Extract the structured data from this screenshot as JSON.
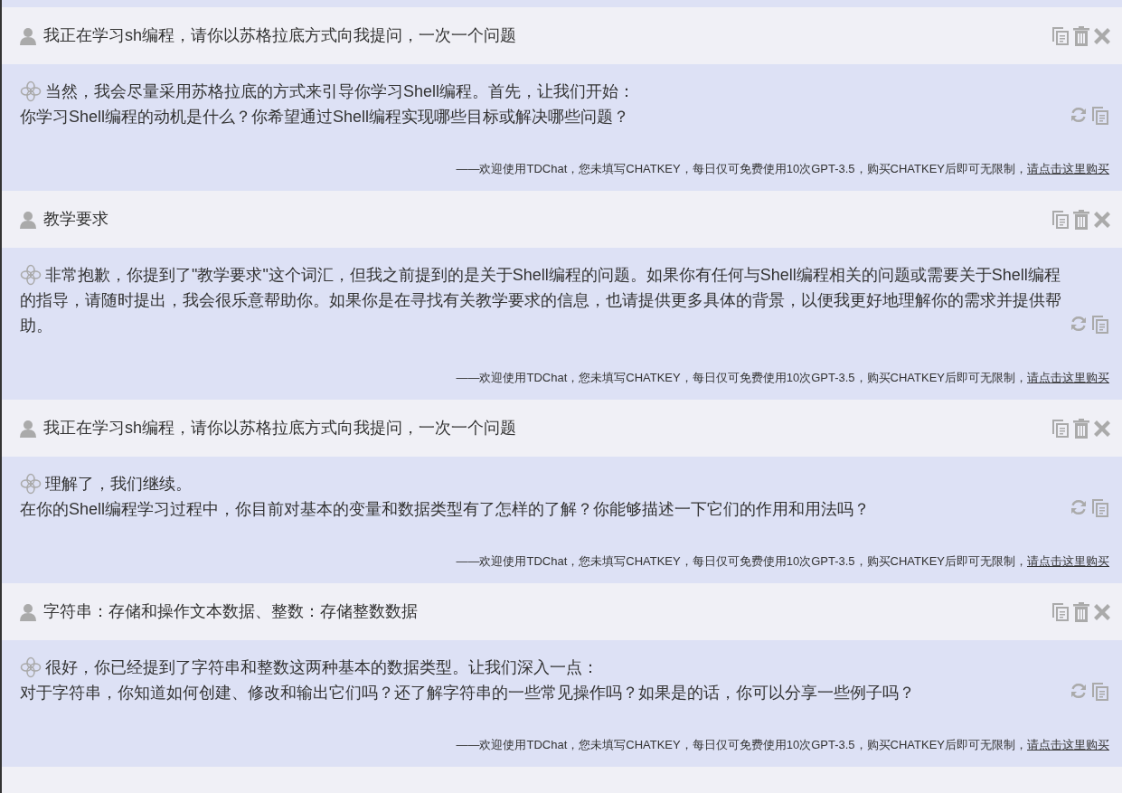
{
  "messages": [
    {
      "kind": "user",
      "text": "我正在学习sh编程，请你以苏格拉底方式向我提问，一次一个问题"
    },
    {
      "kind": "assistant",
      "lines": [
        "当然，我会尽量采用苏格拉底的方式来引导你学习Shell编程。首先，让我们开始：",
        "你学习Shell编程的动机是什么？你希望通过Shell编程实现哪些目标或解决哪些问题？"
      ],
      "notice": "——欢迎使用TDChat，您未填写CHATKEY，每日仅可免费使用10次GPT-3.5，购买CHATKEY后即可无限制，",
      "link": "请点击这里购买"
    },
    {
      "kind": "user",
      "text": "教学要求"
    },
    {
      "kind": "assistant",
      "lines": [
        "非常抱歉，你提到了\"教学要求\"这个词汇，但我之前提到的是关于Shell编程的问题。如果你有任何与Shell编程相关的问题或需要关于Shell编程",
        "的指导，请随时提出，我会很乐意帮助你。如果你是在寻找有关教学要求的信息，也请提供更多具体的背景，以便我更好地理解你的需求并提供帮",
        "助。"
      ],
      "notice": "——欢迎使用TDChat，您未填写CHATKEY，每日仅可免费使用10次GPT-3.5，购买CHATKEY后即可无限制，",
      "link": "请点击这里购买"
    },
    {
      "kind": "user",
      "text": "我正在学习sh编程，请你以苏格拉底方式向我提问，一次一个问题"
    },
    {
      "kind": "assistant",
      "lines": [
        "理解了，我们继续。",
        "在你的Shell编程学习过程中，你目前对基本的变量和数据类型有了怎样的了解？你能够描述一下它们的作用和用法吗？"
      ],
      "notice": "——欢迎使用TDChat，您未填写CHATKEY，每日仅可免费使用10次GPT-3.5，购买CHATKEY后即可无限制，",
      "link": "请点击这里购买"
    },
    {
      "kind": "user",
      "text": "字符串：存储和操作文本数据、整数：存储整数数据"
    },
    {
      "kind": "assistant",
      "lines": [
        "很好，你已经提到了字符串和整数这两种基本的数据类型。让我们深入一点：",
        "对于字符串，你知道如何创建、修改和输出它们吗？还了解字符串的一些常见操作吗？如果是的话，你可以分享一些例子吗？"
      ],
      "notice": "——欢迎使用TDChat，您未填写CHATKEY，每日仅可免费使用10次GPT-3.5，购买CHATKEY后即可无限制，",
      "link": "请点击这里购买"
    }
  ]
}
